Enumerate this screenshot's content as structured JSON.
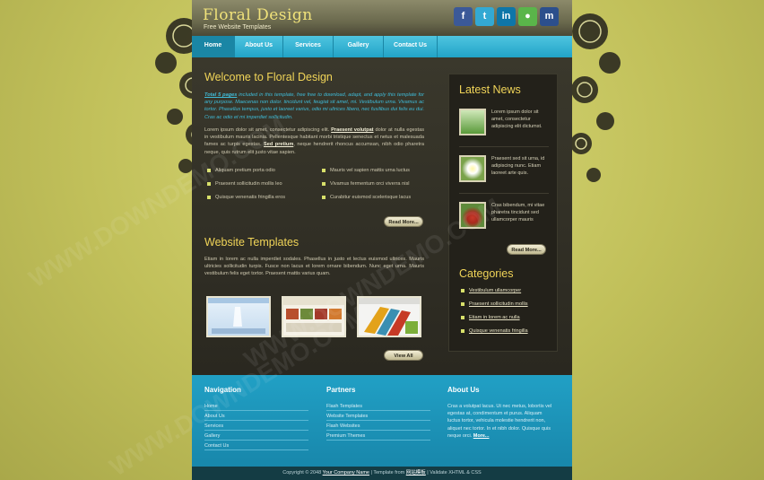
{
  "header": {
    "title": "Floral Design",
    "subtitle": "Free Website Templates",
    "social": [
      {
        "name": "facebook",
        "glyph": "f",
        "color": "#3b5998"
      },
      {
        "name": "twitter",
        "glyph": "t",
        "color": "#33a9d3"
      },
      {
        "name": "linkedin",
        "glyph": "in",
        "color": "#0e76a8"
      },
      {
        "name": "chat",
        "glyph": "●",
        "color": "#5ab54a"
      },
      {
        "name": "myspace",
        "glyph": "m",
        "color": "#2c4f8c"
      }
    ]
  },
  "nav": [
    {
      "label": "Home",
      "active": true
    },
    {
      "label": "About Us",
      "active": false
    },
    {
      "label": "Services",
      "active": false
    },
    {
      "label": "Gallery",
      "active": false
    },
    {
      "label": "Contact Us",
      "active": false
    }
  ],
  "welcome": {
    "title": "Welcome to Floral Design",
    "intro_link": "Total 5 pages",
    "intro": " included in this template, free free to download, adapt, and apply this template for any purpose. Maecenas non dolor. tincidunt vel, feugiat sit amet, mi. Vestibulum urna. Vivamus ac tortor. Phasellus tempus, justo et laoreet varius, odio mi ultrices libero, nec fusilibus dui felis eu dui. Cras ac odio et mi imperdiet sollicitudin.",
    "body_1": "Lorem ipsum dolor sit amet, consectetur adipiscing elit. ",
    "body_link_1": "Praesent volutpat",
    "body_2": " dolor at nulla egestas in vestibulum mauris lacinia. Pellentesque habitant morbi tristique senectus et netus et malesuada fames ac turpis egestas. ",
    "body_link_2": "Sed pretium",
    "body_3": ", neque hendrerit rhoncus accumsan, nibh odio pharetra neque, quis rutrum elit justo vitae sapien.",
    "bullets_left": [
      "Aliquam pretium porta odio",
      "Praesent sollicitudin mollis leo",
      "Quisque venenatis fringilla eros"
    ],
    "bullets_right": [
      "Mauris vel sapien mattis urna luctus",
      "Vivamus fermentum orci viverra nisl",
      "Curabitur euismod scelerisque lacus"
    ],
    "read_more": "Read More..."
  },
  "templates": {
    "title": "Website Templates",
    "body": "Etiam in lorem ac nulla imperdiet sodales. Phasellus in justo et lectus euismod ultrices. Mauris ultricies sollicitudin turpis. Fusce non lacus et lorem ornare bibendum. Nunc eget urna. Mauris vestibulum felis eget tortor. Praesent mattis varius quam.",
    "view_all": "View All"
  },
  "news": {
    "title": "Latest News",
    "items": [
      "Lorem ipsum dolor sit amet, consectetur adipiscing elit dictumst.",
      "Praesent sed sit urna, id adipiscing nunc. Etiam laoreet arte quis.",
      "Cras bibendum, mi vitae pharetra tincidunt sed ullamcorper mauris"
    ],
    "read_more": "Read More..."
  },
  "categories": {
    "title": "Categories",
    "items": [
      "Vestibulum ullamcorper",
      "Praesent sollicitudin mollis",
      "Etiam in lorem ac nulla",
      "Quisque venenatis fringilla"
    ]
  },
  "footer": {
    "navigation": {
      "title": "Navigation",
      "links": [
        "Home",
        "About Us",
        "Services",
        "Gallery",
        "Contact Us"
      ]
    },
    "partners": {
      "title": "Partners",
      "links": [
        "Flash Templates",
        "Website Templates",
        "Flash Websites",
        "Premium Themes"
      ]
    },
    "about": {
      "title": "About Us",
      "text": "Cras a volutpat lacus. Ut nec metus, lobortis vel egestas at, condimentum et purus. Aliquam luctus tortor, vehicula molestie hendrerit non, aliquet nec tortor. In et nibh dolor. Quisque quis neque orci. ",
      "more": "More..."
    }
  },
  "copyright": {
    "pre": "Copyright © 2048 ",
    "company": "Your Company Name",
    "mid": " | Template from ",
    "source": "网站模板",
    "post": " | Validate XHTML & CSS"
  },
  "watermark": "WWW.DOWNDEMO.COM"
}
